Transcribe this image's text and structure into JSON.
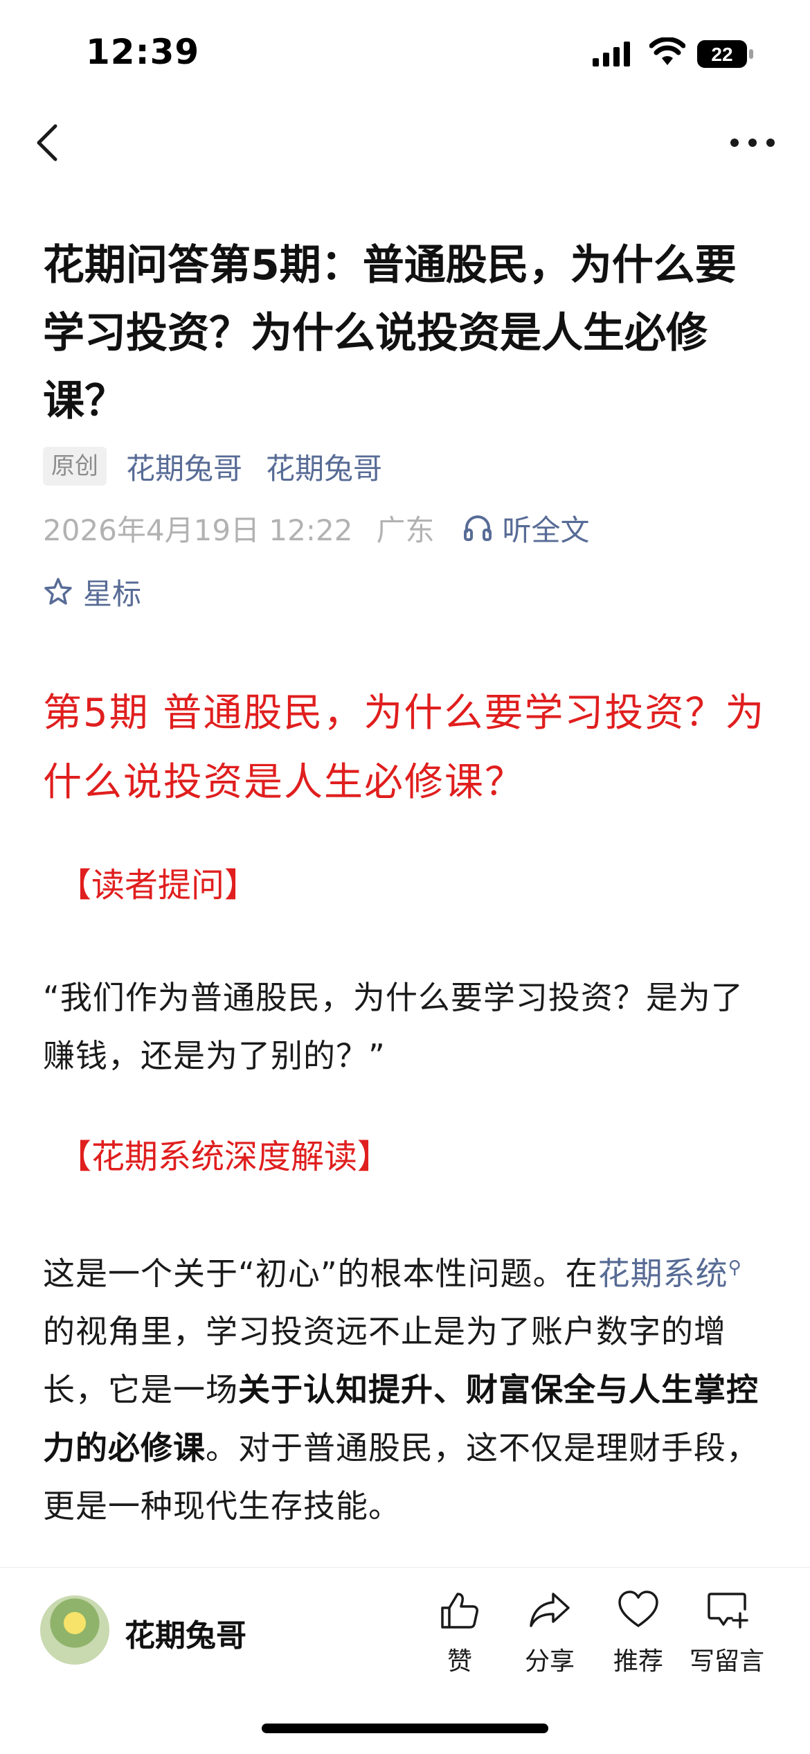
{
  "status_bar": {
    "time": "12:39",
    "battery_level": "22"
  },
  "nav": {
    "back_icon": "chevron-left-icon",
    "more_icon": "ellipsis-icon"
  },
  "article": {
    "title": "花期问答第5期：普通股民，为什么要学习投资？为什么说投资是人生必修课？",
    "original_badge": "原创",
    "author_name": "花期兔哥",
    "account_name": "花期兔哥",
    "date": "2026年4月19日 12:22",
    "location": "广东",
    "listen_label": "听全文",
    "star_label": "星标"
  },
  "content": {
    "heading": "第5期  普通股民，为什么要学习投资？为什么说投资是人生必修课？",
    "section1_title": "【读者提问】",
    "quote": "“我们作为普通股民，为什么要学习投资？是为了赚钱，还是为了别的？”",
    "section2_title": "【花期系统深度解读】",
    "para_part1": "这是一个关于“初心”的根本性问题。在",
    "para_link": "花期系统",
    "para_part2": "的视角里，学习投资远不止是为了账户数字的增长，它是一场",
    "para_bold": "关于认知提升、财富保全与人生掌控力的必修课",
    "para_part3": "。对于普通股民，这不仅是理财手段，更是一种现代生存技能。"
  },
  "bottom_bar": {
    "author": "花期兔哥",
    "like_label": "赞",
    "share_label": "分享",
    "recommend_label": "推荐",
    "comment_label": "写留言"
  },
  "colors": {
    "link": "#576b95",
    "accent_red": "#e01e1e",
    "meta_gray": "#b2b2b2"
  }
}
